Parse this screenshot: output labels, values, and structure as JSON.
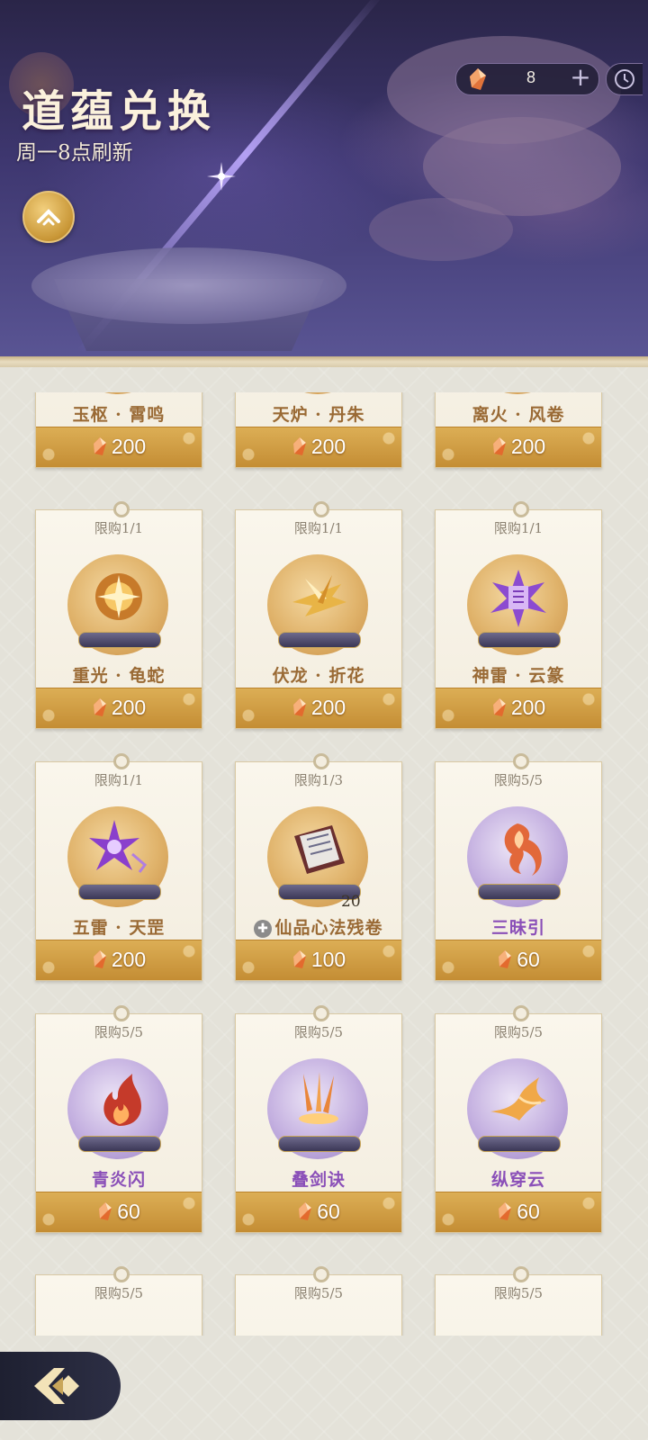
{
  "header": {
    "title": "道蕴兑换",
    "refresh_note": "周一8点刷新",
    "currency_count": "8"
  },
  "cards": [
    {
      "limit": "",
      "name": "玉枢 · 霄鸣",
      "price": "200",
      "theme": "gold",
      "partial": true
    },
    {
      "limit": "",
      "name": "天炉 · 丹朱",
      "price": "200",
      "theme": "gold",
      "partial": true
    },
    {
      "limit": "",
      "name": "离火 · 风卷",
      "price": "200",
      "theme": "gold",
      "partial": true
    },
    {
      "limit": "限购1/1",
      "name": "重光 · 龟蛇",
      "price": "200",
      "theme": "gold",
      "art": "burst-orb-icon"
    },
    {
      "limit": "限购1/1",
      "name": "伏龙 · 折花",
      "price": "200",
      "theme": "gold",
      "art": "golden-shards-icon"
    },
    {
      "limit": "限购1/1",
      "name": "神雷 · 云篆",
      "price": "200",
      "theme": "gold",
      "art": "purple-lightning-icon"
    },
    {
      "limit": "限购1/1",
      "name": "五雷 · 天罡",
      "price": "200",
      "theme": "gold",
      "art": "purple-star-icon"
    },
    {
      "limit": "限购1/3",
      "name": "仙品心法残卷",
      "price": "100",
      "theme": "gold",
      "art": "scroll-book-icon",
      "qty": "20",
      "badge": true
    },
    {
      "limit": "限购5/5",
      "name": "三昧引",
      "price": "60",
      "theme": "purple",
      "art": "flame-wisp-icon"
    },
    {
      "limit": "限购5/5",
      "name": "青炎闪",
      "price": "60",
      "theme": "purple",
      "art": "red-flame-icon"
    },
    {
      "limit": "限购5/5",
      "name": "叠剑诀",
      "price": "60",
      "theme": "purple",
      "art": "flying-swords-icon"
    },
    {
      "limit": "限购5/5",
      "name": "纵穿云",
      "price": "60",
      "theme": "purple",
      "art": "phoenix-icon"
    },
    {
      "limit": "限购5/5",
      "name": "",
      "price": "",
      "theme": "purple",
      "partial_bottom": true
    },
    {
      "limit": "限购5/5",
      "name": "",
      "price": "",
      "theme": "purple",
      "partial_bottom": true
    },
    {
      "limit": "限购5/5",
      "name": "",
      "price": "",
      "theme": "purple",
      "partial_bottom": true
    }
  ],
  "icons": {
    "currency": "crystal-gem-icon",
    "add": "plus-icon",
    "history": "clock-icon",
    "expand": "expand-up-icon",
    "back": "back-arrow-icon"
  },
  "colors": {
    "banner_top": "#2a2548",
    "price_bar": "#d4a048",
    "name_gold": "#9a6a35",
    "name_purple": "#8a4fb8"
  }
}
